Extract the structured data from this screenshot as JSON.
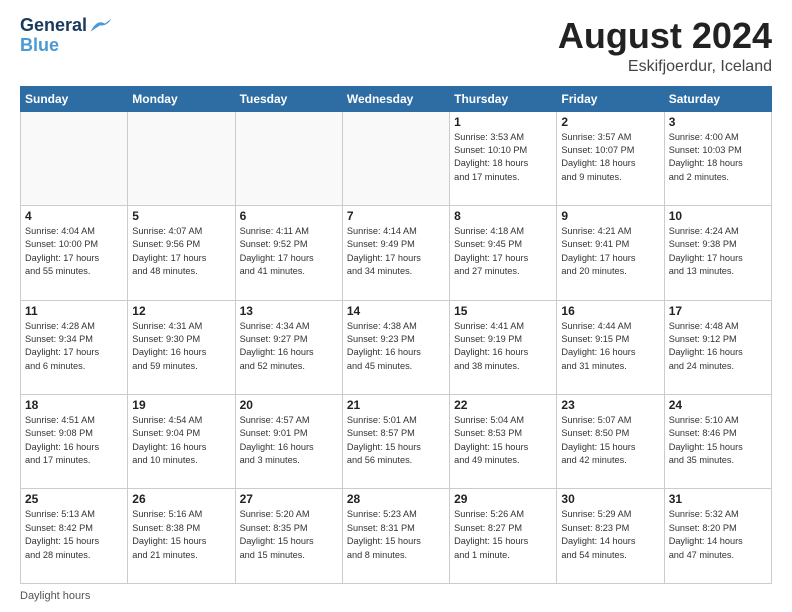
{
  "header": {
    "logo_line1": "General",
    "logo_line2": "Blue",
    "month_year": "August 2024",
    "location": "Eskifjoerdur, Iceland"
  },
  "weekdays": [
    "Sunday",
    "Monday",
    "Tuesday",
    "Wednesday",
    "Thursday",
    "Friday",
    "Saturday"
  ],
  "footer_label": "Daylight hours",
  "weeks": [
    [
      {
        "day": "",
        "info": ""
      },
      {
        "day": "",
        "info": ""
      },
      {
        "day": "",
        "info": ""
      },
      {
        "day": "",
        "info": ""
      },
      {
        "day": "1",
        "info": "Sunrise: 3:53 AM\nSunset: 10:10 PM\nDaylight: 18 hours\nand 17 minutes."
      },
      {
        "day": "2",
        "info": "Sunrise: 3:57 AM\nSunset: 10:07 PM\nDaylight: 18 hours\nand 9 minutes."
      },
      {
        "day": "3",
        "info": "Sunrise: 4:00 AM\nSunset: 10:03 PM\nDaylight: 18 hours\nand 2 minutes."
      }
    ],
    [
      {
        "day": "4",
        "info": "Sunrise: 4:04 AM\nSunset: 10:00 PM\nDaylight: 17 hours\nand 55 minutes."
      },
      {
        "day": "5",
        "info": "Sunrise: 4:07 AM\nSunset: 9:56 PM\nDaylight: 17 hours\nand 48 minutes."
      },
      {
        "day": "6",
        "info": "Sunrise: 4:11 AM\nSunset: 9:52 PM\nDaylight: 17 hours\nand 41 minutes."
      },
      {
        "day": "7",
        "info": "Sunrise: 4:14 AM\nSunset: 9:49 PM\nDaylight: 17 hours\nand 34 minutes."
      },
      {
        "day": "8",
        "info": "Sunrise: 4:18 AM\nSunset: 9:45 PM\nDaylight: 17 hours\nand 27 minutes."
      },
      {
        "day": "9",
        "info": "Sunrise: 4:21 AM\nSunset: 9:41 PM\nDaylight: 17 hours\nand 20 minutes."
      },
      {
        "day": "10",
        "info": "Sunrise: 4:24 AM\nSunset: 9:38 PM\nDaylight: 17 hours\nand 13 minutes."
      }
    ],
    [
      {
        "day": "11",
        "info": "Sunrise: 4:28 AM\nSunset: 9:34 PM\nDaylight: 17 hours\nand 6 minutes."
      },
      {
        "day": "12",
        "info": "Sunrise: 4:31 AM\nSunset: 9:30 PM\nDaylight: 16 hours\nand 59 minutes."
      },
      {
        "day": "13",
        "info": "Sunrise: 4:34 AM\nSunset: 9:27 PM\nDaylight: 16 hours\nand 52 minutes."
      },
      {
        "day": "14",
        "info": "Sunrise: 4:38 AM\nSunset: 9:23 PM\nDaylight: 16 hours\nand 45 minutes."
      },
      {
        "day": "15",
        "info": "Sunrise: 4:41 AM\nSunset: 9:19 PM\nDaylight: 16 hours\nand 38 minutes."
      },
      {
        "day": "16",
        "info": "Sunrise: 4:44 AM\nSunset: 9:15 PM\nDaylight: 16 hours\nand 31 minutes."
      },
      {
        "day": "17",
        "info": "Sunrise: 4:48 AM\nSunset: 9:12 PM\nDaylight: 16 hours\nand 24 minutes."
      }
    ],
    [
      {
        "day": "18",
        "info": "Sunrise: 4:51 AM\nSunset: 9:08 PM\nDaylight: 16 hours\nand 17 minutes."
      },
      {
        "day": "19",
        "info": "Sunrise: 4:54 AM\nSunset: 9:04 PM\nDaylight: 16 hours\nand 10 minutes."
      },
      {
        "day": "20",
        "info": "Sunrise: 4:57 AM\nSunset: 9:01 PM\nDaylight: 16 hours\nand 3 minutes."
      },
      {
        "day": "21",
        "info": "Sunrise: 5:01 AM\nSunset: 8:57 PM\nDaylight: 15 hours\nand 56 minutes."
      },
      {
        "day": "22",
        "info": "Sunrise: 5:04 AM\nSunset: 8:53 PM\nDaylight: 15 hours\nand 49 minutes."
      },
      {
        "day": "23",
        "info": "Sunrise: 5:07 AM\nSunset: 8:50 PM\nDaylight: 15 hours\nand 42 minutes."
      },
      {
        "day": "24",
        "info": "Sunrise: 5:10 AM\nSunset: 8:46 PM\nDaylight: 15 hours\nand 35 minutes."
      }
    ],
    [
      {
        "day": "25",
        "info": "Sunrise: 5:13 AM\nSunset: 8:42 PM\nDaylight: 15 hours\nand 28 minutes."
      },
      {
        "day": "26",
        "info": "Sunrise: 5:16 AM\nSunset: 8:38 PM\nDaylight: 15 hours\nand 21 minutes."
      },
      {
        "day": "27",
        "info": "Sunrise: 5:20 AM\nSunset: 8:35 PM\nDaylight: 15 hours\nand 15 minutes."
      },
      {
        "day": "28",
        "info": "Sunrise: 5:23 AM\nSunset: 8:31 PM\nDaylight: 15 hours\nand 8 minutes."
      },
      {
        "day": "29",
        "info": "Sunrise: 5:26 AM\nSunset: 8:27 PM\nDaylight: 15 hours\nand 1 minute."
      },
      {
        "day": "30",
        "info": "Sunrise: 5:29 AM\nSunset: 8:23 PM\nDaylight: 14 hours\nand 54 minutes."
      },
      {
        "day": "31",
        "info": "Sunrise: 5:32 AM\nSunset: 8:20 PM\nDaylight: 14 hours\nand 47 minutes."
      }
    ]
  ]
}
